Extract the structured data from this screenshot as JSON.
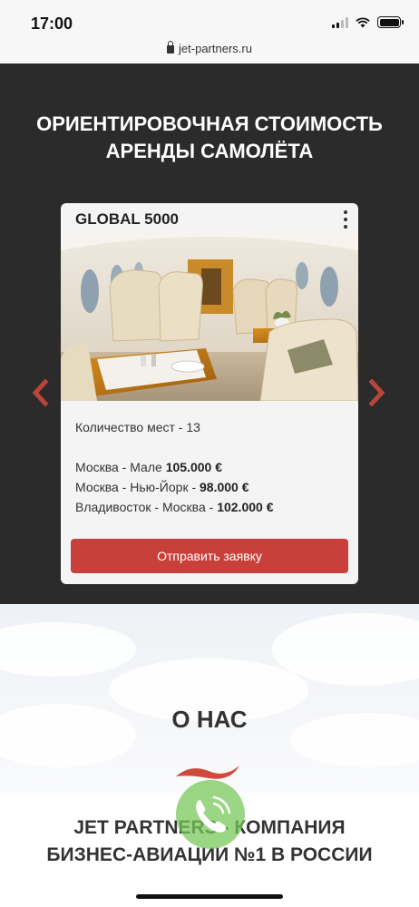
{
  "status_bar": {
    "time": "17:00"
  },
  "browser": {
    "url": "jet-partners.ru"
  },
  "pricing": {
    "title_line1": "ОРИЕНТИРОВОЧНАЯ СТОИМОСТЬ",
    "title_line2": "АРЕНДЫ САМОЛЁТА"
  },
  "card": {
    "name": "GLOBAL 5000",
    "seats": "Количество мест - 13",
    "routes": [
      {
        "route": "Москва - Мале ",
        "price": "105.000 €"
      },
      {
        "route": "Москва - Нью-Йорк - ",
        "price": "98.000 €"
      },
      {
        "route": "Владивосток - Москва - ",
        "price": "102.000 €"
      }
    ],
    "button_label": "Отправить заявку"
  },
  "about": {
    "title": "О НАС",
    "company_line1": "JET PARTNERS - КОМПАНИЯ",
    "company_line2": "БИЗНЕС-АВИАЦИИ №1 В РОССИИ"
  },
  "colors": {
    "accent": "#c9403a",
    "dark_bg": "#2b2b2b",
    "call_green": "#78c85a"
  }
}
